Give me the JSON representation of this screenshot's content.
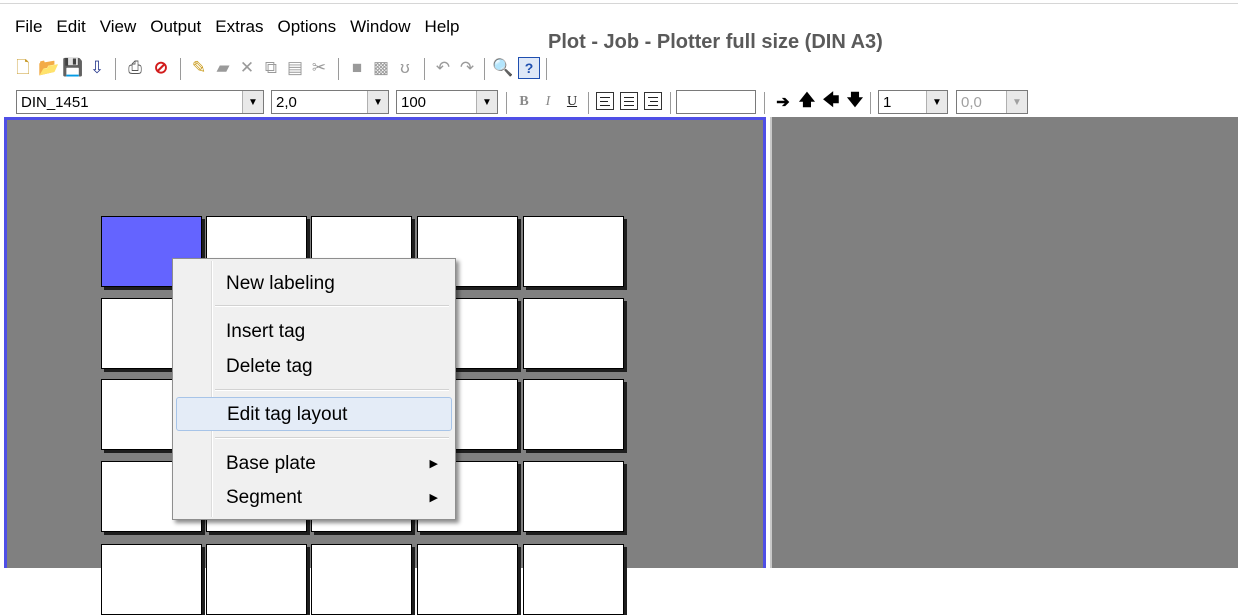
{
  "menubar": {
    "items": [
      "File",
      "Edit",
      "View",
      "Output",
      "Extras",
      "Options",
      "Window",
      "Help"
    ]
  },
  "toolbar": {
    "title": "Plot - Job - Plotter full size (DIN A3)",
    "font_combo": "DIN_1451",
    "size_combo": "2,0",
    "scale_combo": "100",
    "step_combo": "1",
    "offset_combo": "0,0",
    "bold_label": "B",
    "italic_label": "I",
    "underline_label": "U"
  },
  "context_menu": {
    "new_labeling": "New labeling",
    "insert_tag": "Insert tag",
    "delete_tag": "Delete tag",
    "edit_tag_layout": "Edit tag layout",
    "base_plate": "Base plate",
    "segment": "Segment"
  },
  "colors": {
    "selected_tag": "#6464ff",
    "panel_bg": "#808080",
    "active_border": "#4f4fe6"
  }
}
